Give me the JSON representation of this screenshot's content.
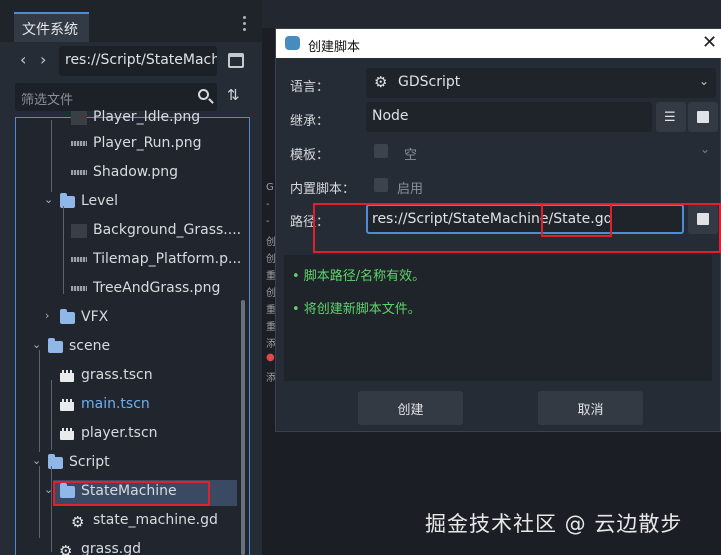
{
  "dock": {
    "tab": "文件系统",
    "path": "res://Script/StateMach",
    "filter_placeholder": "筛选文件"
  },
  "tree": {
    "items": [
      "Player_Idle.png",
      "Player_Run.png",
      "Shadow.png",
      "Level",
      "Background_Grass....",
      "Tilemap_Platform.p...",
      "TreeAndGrass.png",
      "VFX",
      "scene",
      "grass.tscn",
      "main.tscn",
      "player.tscn",
      "Script",
      "StateMachine",
      "state_machine.gd",
      "grass.gd"
    ]
  },
  "code": {
    "lines": [
      "G",
      "-",
      "-",
      "创",
      "创",
      "重",
      "创",
      "重",
      "重",
      "添",
      "●",
      "添"
    ]
  },
  "dialog": {
    "title": "创建脚本",
    "language_label": "语言：",
    "language_value": "GDScript",
    "inherits_label": "继承：",
    "inherits_value": "Node",
    "template_label": "模板：",
    "template_value": "空",
    "builtin_label": "内置脚本：",
    "builtin_value": "启用",
    "path_label": "路径：",
    "path_value": "res://Script/StateMachine/State.gd",
    "status": [
      "• 脚本路径/名称有效。",
      "• 将创建新脚本文件。"
    ],
    "create_button": "创建",
    "cancel_button": "取消"
  },
  "watermark": "掘金技术社区 @ 云边散步",
  "colors": {
    "accent": "#4f8bd6",
    "ok_text": "#5fd36a",
    "highlight": "#e0202a",
    "link": "#6ab0f0"
  }
}
